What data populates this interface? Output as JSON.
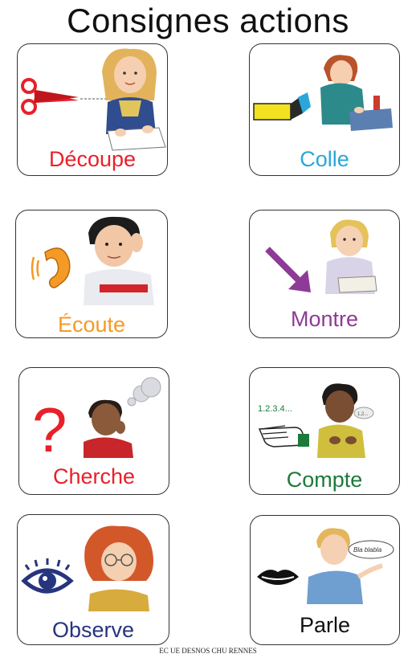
{
  "title": "Consignes actions",
  "footer": "EC UE DESNOS CHU  RENNES",
  "cards": [
    {
      "label": "Découpe",
      "color": "#e8202a",
      "icon": "scissors-icon",
      "illustration": "girl-cutting"
    },
    {
      "label": "Colle",
      "color": "#2aa7d8",
      "icon": "glue-stick-icon",
      "illustration": "girl-gluing"
    },
    {
      "label": "Écoute",
      "color": "#f59a24",
      "icon": "ear-icon",
      "illustration": "boy-listening"
    },
    {
      "label": "Montre",
      "color": "#8e3a97",
      "icon": "arrow-down-right-icon",
      "illustration": "girl-pointing"
    },
    {
      "label": "Cherche",
      "color": "#e8202a",
      "icon": "question-mark-icon",
      "illustration": "boy-thinking"
    },
    {
      "label": "Compte",
      "color": "#1c7a3a",
      "icon": "counting-hand-icon",
      "illustration": "boy-counting",
      "icon_text": "1.2.3.4...",
      "bubble_text": "1,2..."
    },
    {
      "label": "Observe",
      "color": "#27357e",
      "icon": "eye-icon",
      "illustration": "child-observing"
    },
    {
      "label": "Parle",
      "color": "#111111",
      "icon": "mouth-icon",
      "illustration": "boy-talking",
      "bubble_text": "Bla blabla"
    }
  ]
}
